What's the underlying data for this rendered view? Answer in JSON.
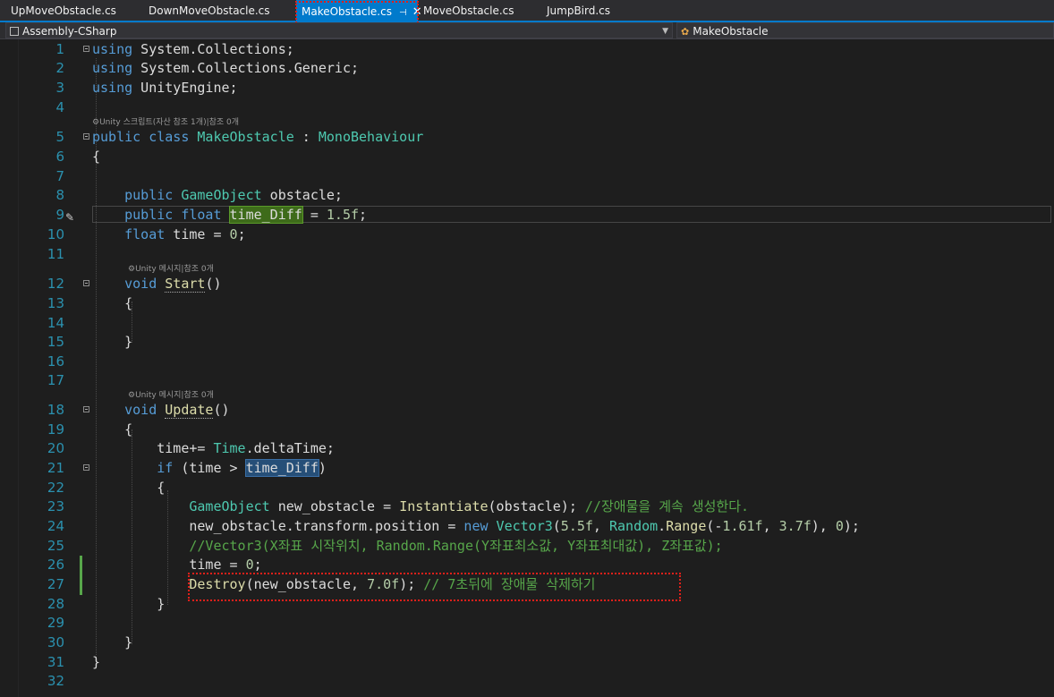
{
  "tabs": [
    {
      "label": "UpMoveObstacle.cs"
    },
    {
      "label": "DownMoveObstacle.cs"
    },
    {
      "label": "MakeObstacle.cs",
      "active": true
    },
    {
      "label": "MoveObstacle.cs"
    },
    {
      "label": "JumpBird.cs"
    }
  ],
  "nav": {
    "project": "Assembly-CSharp",
    "class": "MakeObstacle"
  },
  "hints": {
    "class_hint": "Unity 스크립트(자산 참조 1개)|참조 0개",
    "start_hint": "Unity 메시지|참조 0개",
    "update_hint": "Unity 메시지|참조 0개"
  },
  "line_numbers": [
    "1",
    "2",
    "3",
    "4",
    "5",
    "6",
    "7",
    "8",
    "9",
    "10",
    "11",
    "12",
    "13",
    "14",
    "15",
    "16",
    "17",
    "18",
    "19",
    "20",
    "21",
    "22",
    "23",
    "24",
    "25",
    "26",
    "27",
    "28",
    "29",
    "30",
    "31",
    "32"
  ],
  "code": {
    "l1_kw": "using",
    "l1_rest": " System.Collections;",
    "l2_kw": "using",
    "l2_rest": " System.Collections.Generic;",
    "l3_kw": "using",
    "l3_rest": " UnityEngine;",
    "l5_kw": "public class",
    "l5_sp": " ",
    "l5_name": "MakeObstacle",
    "l5_mid": " : ",
    "l5_base": "MonoBehaviour",
    "l6": "{",
    "l8_kw": "    public",
    "l8_sp": " ",
    "l8_type": "GameObject",
    "l8_rest": " obstacle;",
    "l9_kw": "    public float",
    "l9_sp": " ",
    "l9_var": "time_Diff",
    "l9_mid": " = ",
    "l9_num": "1.5f",
    "l9_end": ";",
    "l10_kw": "    float",
    "l10_mid": " time = ",
    "l10_num": "0",
    "l10_end": ";",
    "l12_kw": "    void",
    "l12_sp": " ",
    "l12_name": "Start",
    "l12_end": "()",
    "l13": "    {",
    "l15": "    }",
    "l18_kw": "    void",
    "l18_sp": " ",
    "l18_name": "Update",
    "l18_end": "()",
    "l19": "    {",
    "l20_a": "        time+= ",
    "l20_type": "Time",
    "l20_b": ".deltaTime;",
    "l21_kw": "        if",
    "l21_a": " (time > ",
    "l21_var": "time_Diff",
    "l21_b": ")",
    "l22": "        {",
    "l23_pad": "            ",
    "l23_type": "GameObject",
    "l23_a": " new_obstacle = ",
    "l23_m": "Instantiate",
    "l23_b": "(obstacle); ",
    "l23_c": "//장애물을 계속 생성한다.",
    "l24_a": "            new_obstacle.transform.position = ",
    "l24_kw": "new",
    "l24_sp": " ",
    "l24_type": "Vector3",
    "l24_b": "(",
    "l24_n1": "5.5f",
    "l24_c": ", ",
    "l24_type2": "Random",
    "l24_d": ".",
    "l24_m": "Range",
    "l24_e": "(-",
    "l24_n2": "1.61f",
    "l24_f": ", ",
    "l24_n3": "3.7f",
    "l24_g": "), ",
    "l24_n4": "0",
    "l24_h": ");",
    "l25_pad": "            ",
    "l25_c": "//Vector3(X좌표 시작위치, Random.Range(Y좌표최소값, Y좌표최대값), Z좌표값);",
    "l26_a": "            time = ",
    "l26_n": "0",
    "l26_b": ";",
    "l27_pad": "            ",
    "l27_m": "Destroy",
    "l27_a": "(new_obstacle, ",
    "l27_n": "7.0f",
    "l27_b": "); ",
    "l27_c": "// 7초뒤에 장애물 삭제하기",
    "l28": "        }",
    "l30": "    }",
    "l31": "}"
  },
  "colors": {
    "keyword": "#569cd6",
    "type": "#4ec9b0",
    "method": "#dcdcaa",
    "comment": "#57a64a",
    "number": "#b5cea8",
    "line_number": "#2b91af",
    "accent": "#007acc",
    "annotation": "#e0201a"
  },
  "icons": {
    "tab_pin": "pin-icon",
    "tab_close": "close-icon",
    "project_icon": "csharp-project-icon",
    "class_icon": "class-icon",
    "edit_icon": "pencil-icon",
    "dropdown": "chevron-down-icon"
  }
}
